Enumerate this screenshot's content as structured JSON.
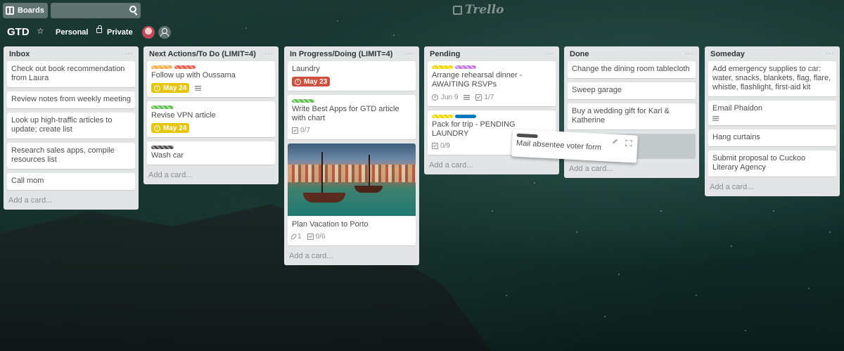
{
  "header": {
    "boards_label": "Boards",
    "search_value": "",
    "logo_text": "Trello"
  },
  "board": {
    "title": "GTD",
    "visibility_team": "Personal",
    "visibility_privacy": "Private"
  },
  "colors": {
    "label_orange": "#ffab4a",
    "label_red": "#eb5a46",
    "label_green": "#61bd4f",
    "label_yellow": "#f2d600",
    "label_purple": "#c377e0",
    "label_blue": "#0079bf",
    "label_black": "#4d4d4d",
    "due_yellow": "#e6c60d",
    "due_red": "#cf513d"
  },
  "lists": [
    {
      "title": "Inbox",
      "menu": "...",
      "cards": [
        {
          "title": "Check out book recommendation from Laura"
        },
        {
          "title": "Review notes from weekly meeting"
        },
        {
          "title": "Look up high-traffic articles to update; create list"
        },
        {
          "title": "Research sales apps, compile resources list"
        },
        {
          "title": "Call mom"
        }
      ],
      "add_label": "Add a card..."
    },
    {
      "title": "Next Actions/To Do (LIMIT=4)",
      "menu": "...",
      "cards": [
        {
          "title": "Follow up with Oussama",
          "due": "May 24"
        },
        {
          "title": "Revise VPN article",
          "due": "May 24"
        },
        {
          "title": "Wash car"
        }
      ],
      "add_label": "Add a card..."
    },
    {
      "title": "In Progress/Doing (LIMIT=4)",
      "menu": "...",
      "cards": [
        {
          "title": "Laundry",
          "due": "May 23"
        },
        {
          "title": "Write Best Apps for GTD article with chart",
          "checklist": "0/7"
        },
        {
          "title": "Plan Vacation to Porto",
          "attachments": "1",
          "checklist": "0/6"
        }
      ],
      "add_label": "Add a card..."
    },
    {
      "title": "Pending",
      "menu": "...",
      "cards": [
        {
          "title": "Arrange rehearsal dinner - AWAITING RSVPs",
          "due": "Jun 9",
          "checklist": "1/7"
        },
        {
          "title": "Pack for trip - PENDING LAUNDRY",
          "checklist": "0/9"
        }
      ],
      "add_label": "Add a card..."
    },
    {
      "title": "Done",
      "menu": "...",
      "cards": [
        {
          "title": "Change the dining room tablecloth"
        },
        {
          "title": "Sweep garage"
        },
        {
          "title": "Buy a wedding gift for Karl & Katherine"
        }
      ],
      "add_label": "Add a card..."
    },
    {
      "title": "Someday",
      "menu": "...",
      "cards": [
        {
          "title": "Add emergency supplies to car: water, snacks, blankets, flag, flare, whistle, flashlight, first-aid kit"
        },
        {
          "title": "Email Phaidon"
        },
        {
          "title": "Hang curtains"
        },
        {
          "title": "Submit proposal to Cuckoo Literary Agency"
        }
      ],
      "add_label": "Add a card..."
    }
  ],
  "dragging_card": {
    "title": "Mail absentee voter form"
  }
}
